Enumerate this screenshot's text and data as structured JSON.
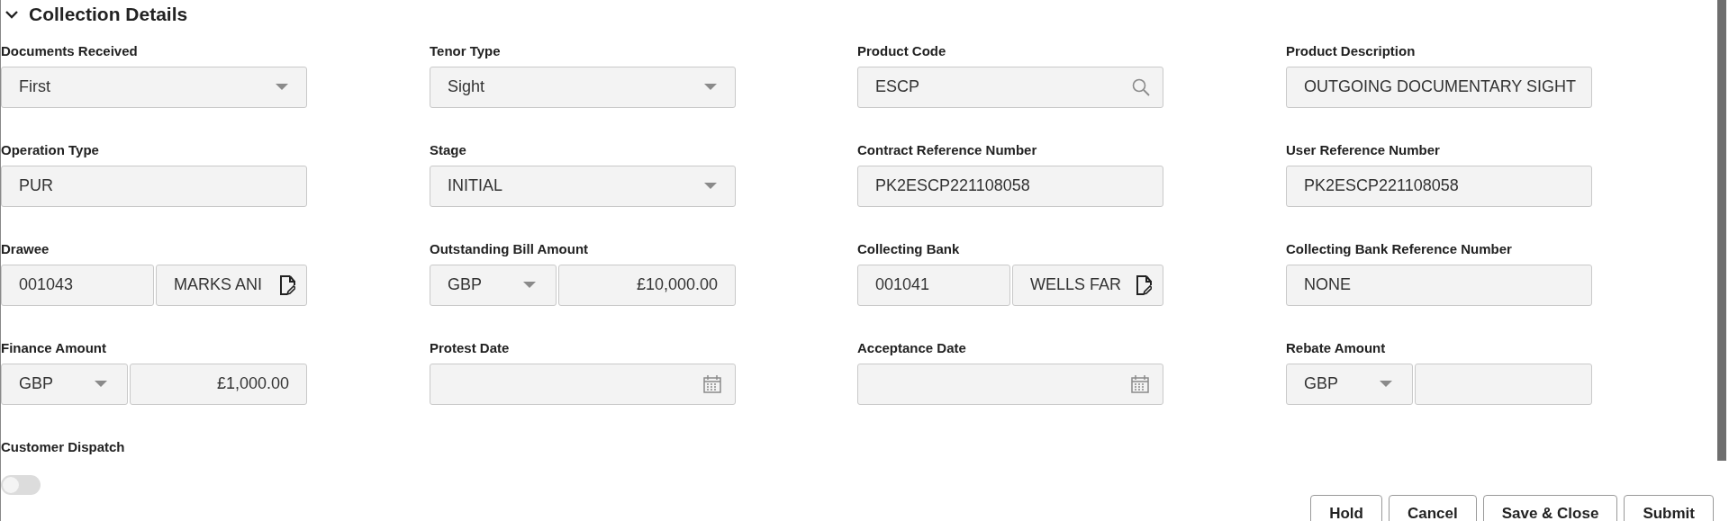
{
  "section": {
    "title": "Collection Details",
    "expanded": true
  },
  "fields": [
    {
      "label": "Documents Received",
      "kind": "select",
      "value": "First"
    },
    {
      "label": "Tenor Type",
      "kind": "select",
      "value": "Sight"
    },
    {
      "label": "Product Code",
      "kind": "lookup",
      "value": "ESCP"
    },
    {
      "label": "Product Description",
      "kind": "text",
      "value": "OUTGOING DOCUMENTARY SIGHT"
    },
    {
      "label": "Operation Type",
      "kind": "text",
      "value": "PUR"
    },
    {
      "label": "Stage",
      "kind": "select",
      "value": "INITIAL"
    },
    {
      "label": "Contract Reference Number",
      "kind": "text",
      "value": "PK2ESCP221108058"
    },
    {
      "label": "User Reference Number",
      "kind": "text",
      "value": "PK2ESCP221108058"
    },
    {
      "label": "Drawee",
      "kind": "party",
      "code": "001043",
      "name": "MARKS ANI"
    },
    {
      "label": "Outstanding Bill Amount",
      "kind": "amount",
      "currency": "GBP",
      "amount": "£10,000.00"
    },
    {
      "label": "Collecting Bank",
      "kind": "party",
      "code": "001041",
      "name": "WELLS FAR"
    },
    {
      "label": "Collecting Bank Reference Number",
      "kind": "text",
      "value": "NONE"
    },
    {
      "label": "Finance Amount",
      "kind": "amount",
      "currency": "GBP",
      "amount": "£1,000.00"
    },
    {
      "label": "Protest Date",
      "kind": "date"
    },
    {
      "label": "Acceptance Date",
      "kind": "date"
    },
    {
      "label": "Rebate Amount",
      "kind": "amount",
      "currency": "GBP"
    },
    {
      "label": "Customer Dispatch",
      "kind": "toggle",
      "on": false
    }
  ],
  "buttons": [
    "Hold",
    "Cancel",
    "Save & Close",
    "Submit"
  ]
}
